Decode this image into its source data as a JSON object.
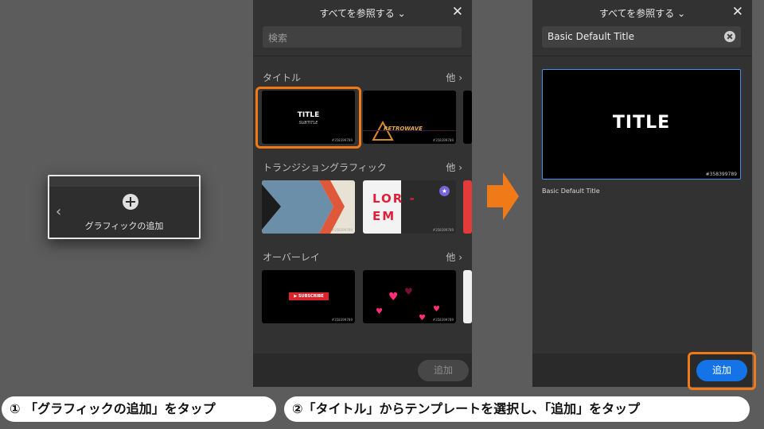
{
  "step1": {
    "add_graphic_label": "グラフィックの追加"
  },
  "panel1": {
    "header_title": "すべてを参照する ⌄",
    "close": "✕",
    "search_placeholder": "検索",
    "sections": [
      {
        "label": "タイトル",
        "more": "他 ›"
      },
      {
        "label": "トランジショングラフィック",
        "more": "他 ›"
      },
      {
        "label": "オーバーレイ",
        "more": "他 ›"
      }
    ],
    "thumb_title": "TITLE",
    "thumb_subtitle": "SUBTITLE",
    "thumb_retro": "RETROWAVE",
    "thumb_lorem_1": "LOR -",
    "thumb_lorem_2": "EM",
    "thumb_subscribe": "▶ SUBSCRIBE",
    "add_label": "追加"
  },
  "panel2": {
    "header_title": "すべてを参照する ⌄",
    "close": "✕",
    "search_value": "Basic Default Title",
    "preview_title": "TITLE",
    "preview_id": "#358399789",
    "preview_label": "Basic Default Title",
    "add_label": "追加"
  },
  "captions": {
    "step1": "① 「グラフィックの追加」をタップ",
    "step2": "②「タイトル」からテンプレートを選択し、「追加」をタップ"
  },
  "colors": {
    "highlight": "#f07a17",
    "accent_blue": "#1473e6",
    "arrow": "#f07a17"
  }
}
